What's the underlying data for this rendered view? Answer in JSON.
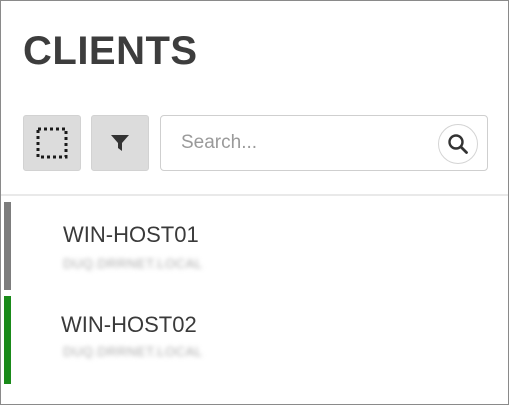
{
  "header": {
    "title": "CLIENTS"
  },
  "toolbar": {
    "select_icon": "dotted-square-select-icon",
    "filter_icon": "funnel-filter-icon"
  },
  "search": {
    "placeholder": "Search...",
    "value": "",
    "icon": "magnifier-icon"
  },
  "clients": [
    {
      "name": "WIN-HOST01",
      "domain": "DUQ.DRRNET.LOCAL",
      "status_color": "#7d7d7d"
    },
    {
      "name": "WIN-HOST02",
      "domain": "DUQ.DRRNET.LOCAL",
      "status_color": "#1a8a1a"
    }
  ]
}
